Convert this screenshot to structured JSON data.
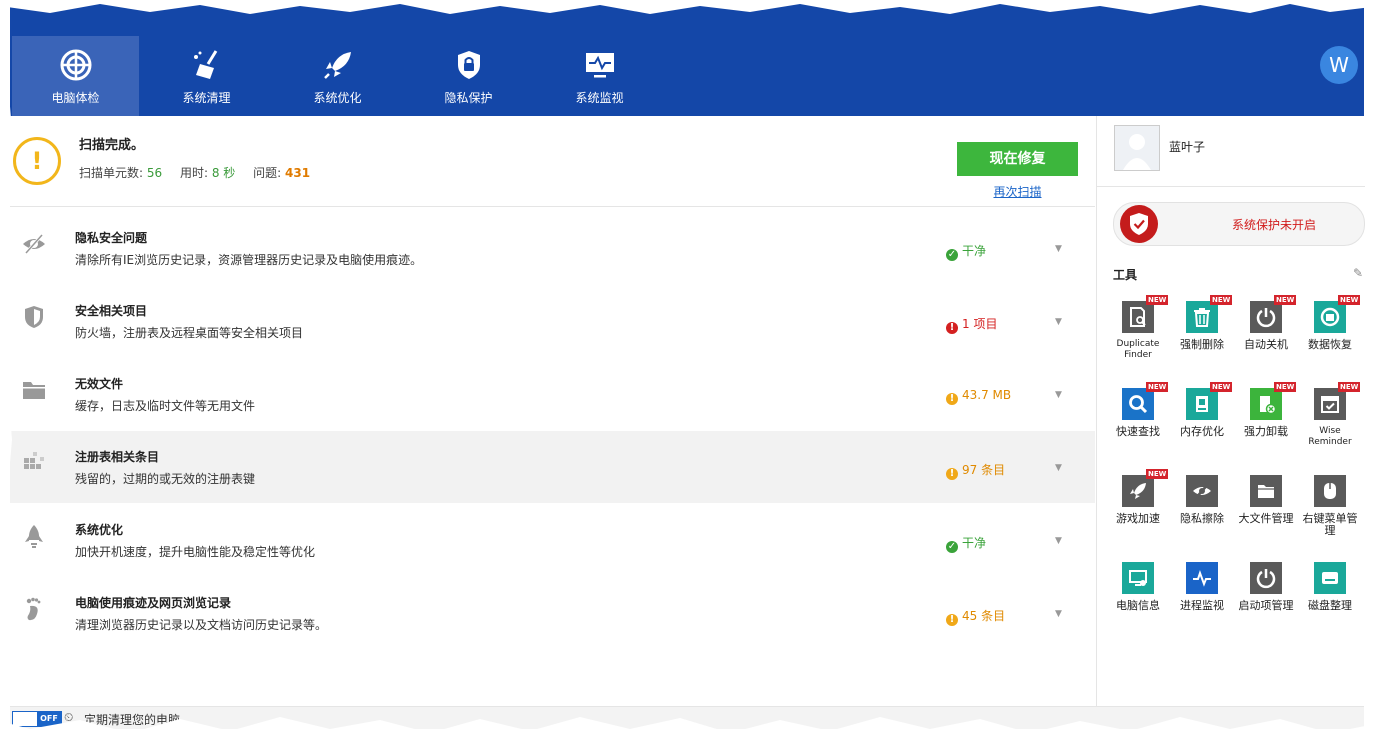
{
  "tabs": [
    {
      "label": "电脑体检",
      "icon": "radar-icon",
      "active": true
    },
    {
      "label": "系统清理",
      "icon": "broom-icon",
      "active": false
    },
    {
      "label": "系统优化",
      "icon": "rocket-icon",
      "active": false
    },
    {
      "label": "隐私保护",
      "icon": "privacy-lock-icon",
      "active": false
    },
    {
      "label": "系统监视",
      "icon": "monitor-pulse-icon",
      "active": false
    }
  ],
  "user_avatar_letter": "W",
  "scan": {
    "title": "扫描完成。",
    "units_label": "扫描单元数:",
    "units_value": "56",
    "time_label": "用时:",
    "time_value": "8 秒",
    "issues_label": "问题:",
    "issues_value": "431",
    "fix_button": "现在修复",
    "rescan_link": "再次扫描"
  },
  "rows": [
    {
      "title": "隐私安全问题",
      "desc": "清除所有IE浏览历史记录，资源管理器历史记录及电脑使用痕迹。",
      "status": "干净",
      "status_type": "ok",
      "icon": "eye-off-icon"
    },
    {
      "title": "安全相关项目",
      "desc": "防火墙，注册表及远程桌面等安全相关项目",
      "status": "1 项目",
      "status_type": "error",
      "icon": "shield-icon"
    },
    {
      "title": "无效文件",
      "desc": "缓存，日志及临时文件等无用文件",
      "status": "43.7 MB",
      "status_type": "warn",
      "icon": "folder-icon"
    },
    {
      "title": "注册表相关条目",
      "desc": "残留的，过期的或无效的注册表键",
      "status": "97 条目",
      "status_type": "warn",
      "icon": "registry-blocks-icon"
    },
    {
      "title": "系统优化",
      "desc": "加快开机速度，提升电脑性能及稳定性等优化",
      "status": "干净",
      "status_type": "ok",
      "icon": "rocket-icon"
    },
    {
      "title": "电脑使用痕迹及网页浏览记录",
      "desc": "清理浏览器历史记录以及文档访问历史记录等。",
      "status": "45 条目",
      "status_type": "warn",
      "icon": "footprint-icon"
    }
  ],
  "sidebar": {
    "username": "蓝叶子",
    "protection_status": "系统保护未开启",
    "tools_title": "工具",
    "new_badge": "NEW",
    "tools": [
      {
        "label": "Duplicate Finder",
        "color": "#5a5a5a",
        "glyph": "doc-search-icon",
        "new": true
      },
      {
        "label": "强制删除",
        "color": "#1aa89a",
        "glyph": "trash-icon",
        "new": true
      },
      {
        "label": "自动关机",
        "color": "#5a5a5a",
        "glyph": "power-icon",
        "new": true
      },
      {
        "label": "数据恢复",
        "color": "#1aa89a",
        "glyph": "recover-icon",
        "new": true
      },
      {
        "label": "快速查找",
        "color": "#1a73c8",
        "glyph": "search-icon",
        "new": true
      },
      {
        "label": "内存优化",
        "color": "#1aa89a",
        "glyph": "memory-icon",
        "new": true
      },
      {
        "label": "强力卸载",
        "color": "#3cb43c",
        "glyph": "uninstall-icon",
        "new": true
      },
      {
        "label": "Wise Reminder",
        "color": "#5a5a5a",
        "glyph": "calendar-check-icon",
        "new": true
      },
      {
        "label": "游戏加速",
        "color": "#5a5a5a",
        "glyph": "rocket-icon",
        "new": true
      },
      {
        "label": "隐私擦除",
        "color": "#5a5a5a",
        "glyph": "eye-off-icon",
        "new": false
      },
      {
        "label": "大文件管理",
        "color": "#5a5a5a",
        "glyph": "folder-icon",
        "new": false
      },
      {
        "label": "右键菜单管理",
        "color": "#5a5a5a",
        "glyph": "mouse-icon",
        "new": false
      },
      {
        "label": "电脑信息",
        "color": "#1aa89a",
        "glyph": "pc-info-icon",
        "new": false
      },
      {
        "label": "进程监视",
        "color": "#1a64c8",
        "glyph": "pulse-icon",
        "new": false
      },
      {
        "label": "启动项管理",
        "color": "#5a5a5a",
        "glyph": "power-icon",
        "new": false
      },
      {
        "label": "磁盘整理",
        "color": "#1aa89a",
        "glyph": "disk-icon",
        "new": false
      }
    ]
  },
  "statusbar": {
    "toggle": "OFF",
    "text": "定期清理您的电脑"
  }
}
